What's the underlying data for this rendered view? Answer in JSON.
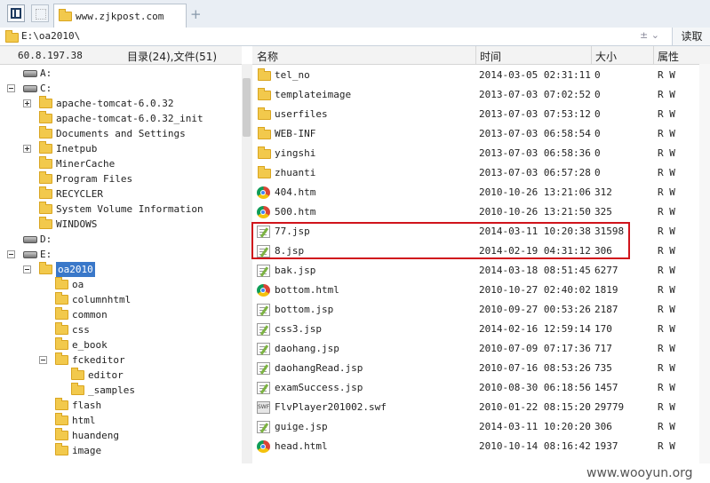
{
  "tab": {
    "title": "www.zjkpost.com",
    "new_tab": "+"
  },
  "address": {
    "path": "E:\\oa2010\\",
    "controls": "± ⌄",
    "read_button": "读取"
  },
  "left_header": {
    "ip": "60.8.197.38",
    "counts": "目录(24),文件(51)"
  },
  "tree": [
    {
      "label": "A:",
      "type": "drive",
      "level": 0,
      "toggle": "none"
    },
    {
      "label": "C:",
      "type": "drive",
      "level": 0,
      "toggle": "minus"
    },
    {
      "label": "apache-tomcat-6.0.32",
      "type": "folder",
      "level": 1,
      "toggle": "plus"
    },
    {
      "label": "apache-tomcat-6.0.32_init",
      "type": "folder",
      "level": 1,
      "toggle": "none"
    },
    {
      "label": "Documents and Settings",
      "type": "folder",
      "level": 1,
      "toggle": "none"
    },
    {
      "label": "Inetpub",
      "type": "folder",
      "level": 1,
      "toggle": "plus"
    },
    {
      "label": "MinerCache",
      "type": "folder",
      "level": 1,
      "toggle": "none"
    },
    {
      "label": "Program Files",
      "type": "folder",
      "level": 1,
      "toggle": "none"
    },
    {
      "label": "RECYCLER",
      "type": "folder",
      "level": 1,
      "toggle": "none"
    },
    {
      "label": "System Volume Information",
      "type": "folder",
      "level": 1,
      "toggle": "none"
    },
    {
      "label": "WINDOWS",
      "type": "folder",
      "level": 1,
      "toggle": "none"
    },
    {
      "label": "D:",
      "type": "drive",
      "level": 0,
      "toggle": "none"
    },
    {
      "label": "E:",
      "type": "drive",
      "level": 0,
      "toggle": "minus"
    },
    {
      "label": "oa2010",
      "type": "folder",
      "level": 1,
      "toggle": "minus",
      "selected": true
    },
    {
      "label": "oa",
      "type": "folder",
      "level": 2,
      "toggle": "none"
    },
    {
      "label": "columnhtml",
      "type": "folder",
      "level": 2,
      "toggle": "none"
    },
    {
      "label": "common",
      "type": "folder",
      "level": 2,
      "toggle": "none"
    },
    {
      "label": "css",
      "type": "folder",
      "level": 2,
      "toggle": "none"
    },
    {
      "label": "e_book",
      "type": "folder",
      "level": 2,
      "toggle": "none"
    },
    {
      "label": "fckeditor",
      "type": "folder",
      "level": 2,
      "toggle": "minus"
    },
    {
      "label": "editor",
      "type": "folder",
      "level": 3,
      "toggle": "none"
    },
    {
      "label": "_samples",
      "type": "folder",
      "level": 3,
      "toggle": "none"
    },
    {
      "label": "flash",
      "type": "folder",
      "level": 2,
      "toggle": "none"
    },
    {
      "label": "html",
      "type": "folder",
      "level": 2,
      "toggle": "none"
    },
    {
      "label": "huandeng",
      "type": "folder",
      "level": 2,
      "toggle": "none"
    },
    {
      "label": "image",
      "type": "folder",
      "level": 2,
      "toggle": "none"
    }
  ],
  "columns": {
    "name": "名称",
    "time": "时间",
    "size": "大小",
    "attr": "属性"
  },
  "files": [
    {
      "name": "tel_no",
      "time": "2014-03-05 02:31:11",
      "size": "0",
      "attr": "R W",
      "icon": "folder"
    },
    {
      "name": "templateimage",
      "time": "2013-07-03 07:02:52",
      "size": "0",
      "attr": "R W",
      "icon": "folder"
    },
    {
      "name": "userfiles",
      "time": "2013-07-03 07:53:12",
      "size": "0",
      "attr": "R W",
      "icon": "folder"
    },
    {
      "name": "WEB-INF",
      "time": "2013-07-03 06:58:54",
      "size": "0",
      "attr": "R W",
      "icon": "folder"
    },
    {
      "name": "yingshi",
      "time": "2013-07-03 06:58:36",
      "size": "0",
      "attr": "R W",
      "icon": "folder"
    },
    {
      "name": "zhuanti",
      "time": "2013-07-03 06:57:28",
      "size": "0",
      "attr": "R W",
      "icon": "folder"
    },
    {
      "name": "404.htm",
      "time": "2010-10-26 13:21:06",
      "size": "312",
      "attr": "R W",
      "icon": "chrome"
    },
    {
      "name": "500.htm",
      "time": "2010-10-26 13:21:50",
      "size": "325",
      "attr": "R W",
      "icon": "chrome"
    },
    {
      "name": "77.jsp",
      "time": "2014-03-11 10:20:38",
      "size": "31598",
      "attr": "R W",
      "icon": "jsp"
    },
    {
      "name": "8.jsp",
      "time": "2014-02-19 04:31:12",
      "size": "306",
      "attr": "R W",
      "icon": "jsp"
    },
    {
      "name": "bak.jsp",
      "time": "2014-03-18 08:51:45",
      "size": "6277",
      "attr": "R W",
      "icon": "jsp"
    },
    {
      "name": "bottom.html",
      "time": "2010-10-27 02:40:02",
      "size": "1819",
      "attr": "R W",
      "icon": "chrome"
    },
    {
      "name": "bottom.jsp",
      "time": "2010-09-27 00:53:26",
      "size": "2187",
      "attr": "R W",
      "icon": "jsp"
    },
    {
      "name": "css3.jsp",
      "time": "2014-02-16 12:59:14",
      "size": "170",
      "attr": "R W",
      "icon": "jsp"
    },
    {
      "name": "daohang.jsp",
      "time": "2010-07-09 07:17:36",
      "size": "717",
      "attr": "R W",
      "icon": "jsp"
    },
    {
      "name": "daohangRead.jsp",
      "time": "2010-07-16 08:53:26",
      "size": "735",
      "attr": "R W",
      "icon": "jsp"
    },
    {
      "name": "examSuccess.jsp",
      "time": "2010-08-30 06:18:56",
      "size": "1457",
      "attr": "R W",
      "icon": "jsp"
    },
    {
      "name": "FlvPlayer201002.swf",
      "time": "2010-01-22 08:15:20",
      "size": "29779",
      "attr": "R W",
      "icon": "swf"
    },
    {
      "name": "guige.jsp",
      "time": "2014-03-11 10:20:20",
      "size": "306",
      "attr": "R W",
      "icon": "jsp"
    },
    {
      "name": "head.html",
      "time": "2010-10-14 08:16:42",
      "size": "1937",
      "attr": "R W",
      "icon": "chrome"
    }
  ],
  "swf_label": "SWF",
  "watermark": "www.wooyun.org",
  "colors": {
    "highlight": "#d0141c",
    "selection": "#3a78c9"
  }
}
